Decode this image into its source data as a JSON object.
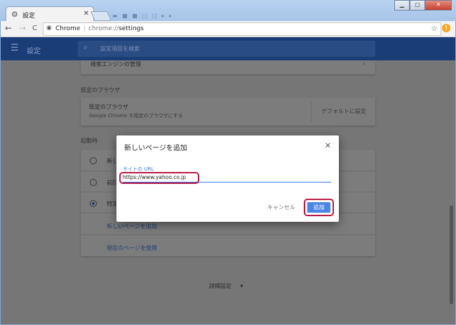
{
  "window": {
    "tab_title": "設定",
    "tab_icon": "gear-icon",
    "blurred_tabs": "▬ ■ ■ ▢ ▢ ▸ ▸",
    "buttons": [
      "▁",
      "▢",
      "✕"
    ]
  },
  "toolbar": {
    "back": "←",
    "forward": "→",
    "reload": "C",
    "site_name": "Chrome",
    "url_prefix": "chrome://",
    "url_path": "settings",
    "star": "☆",
    "alert": "!"
  },
  "header": {
    "title": "設定",
    "search_placeholder": "設定項目を検索"
  },
  "settings": {
    "search_engine_manage": "検索エンジンの管理",
    "default_browser_section": "既定のブラウザ",
    "default_browser_title": "既定のブラウザ",
    "default_browser_desc": "Google Chrome を既定のブラウザにする",
    "make_default_button": "デフォルトに設定",
    "startup_section": "起動時",
    "startup_options": [
      "新し",
      "前回",
      "特定"
    ],
    "add_new_page_link": "新しいページを追加",
    "use_current_pages_link": "現在のページを使用",
    "advanced": "詳細設定",
    "advanced_arrow": "▾"
  },
  "dialog": {
    "title": "新しいページを追加",
    "field_label": "サイトの URL",
    "field_value": "https://www.yahoo.co.jp",
    "cancel_label": "キャンセル",
    "add_label": "追加"
  },
  "colors": {
    "accent": "#4a86e8",
    "header_bg": "#1a3d78",
    "highlight": "#b81a45"
  }
}
